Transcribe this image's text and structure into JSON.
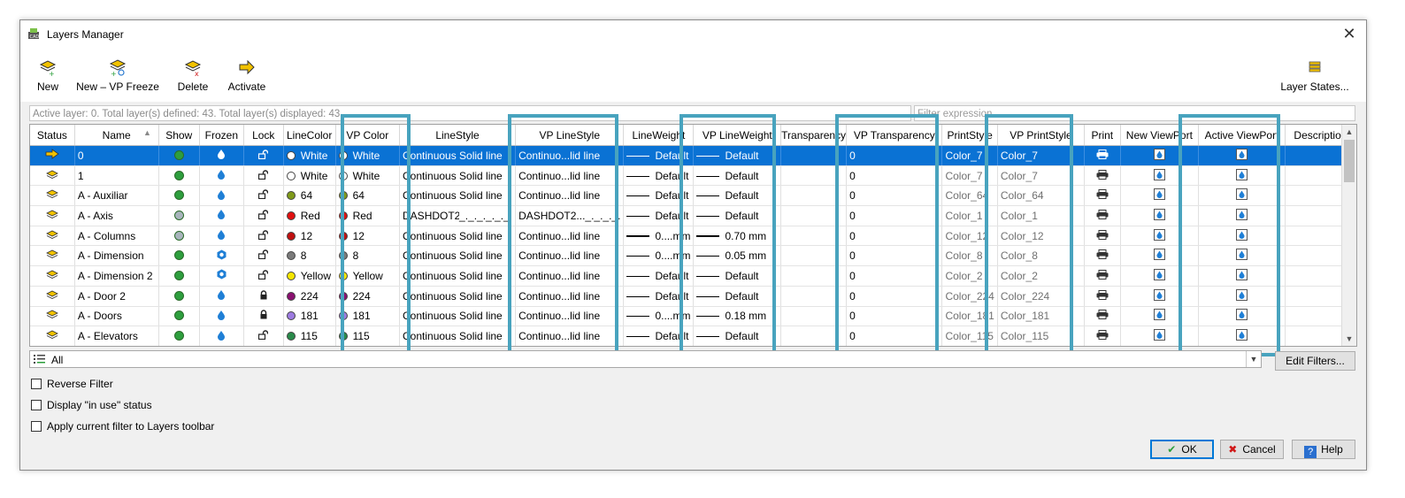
{
  "window": {
    "title": "Layers Manager"
  },
  "toolbar": {
    "new_label": "New",
    "new_vp_freeze_label": "New – VP Freeze",
    "delete_label": "Delete",
    "activate_label": "Activate",
    "layer_states_label": "Layer States..."
  },
  "status_text": "Active layer: 0. Total layer(s) defined: 43. Total layer(s) displayed: 43.",
  "filter_expression_placeholder": "Filter expression",
  "columns": [
    "Status",
    "Name",
    "Show",
    "Frozen",
    "Lock",
    "LineColor",
    "VP Color",
    "LineStyle",
    "VP LineStyle",
    "LineWeight",
    "VP LineWeight",
    "Transparency",
    "VP Transparency",
    "PrintStyle",
    "VP PrintStyle",
    "Print",
    "New ViewPort",
    "Active ViewPort",
    "Description"
  ],
  "rows": [
    {
      "name": "0",
      "show": "#2e9e3e",
      "frozen": "thawed",
      "lock": "unlocked",
      "color": "White",
      "color_hex": "#ffffff",
      "vp_color": "White",
      "vp_color_hex": "#ffffff",
      "linestyle": "Continuous",
      "linestyle_desc": "Solid line",
      "vp_linestyle": "Continuo...lid line",
      "lineweight": "Default",
      "vp_lineweight": "Default",
      "lw_thick": false,
      "transparency": "",
      "vp_transparency": "0",
      "printstyle": "Color_7",
      "vp_printstyle": "Color_7",
      "selected": true
    },
    {
      "name": "1",
      "show": "#2e9e3e",
      "frozen": "thawed",
      "lock": "unlocked",
      "color": "White",
      "color_hex": "#ffffff",
      "vp_color": "White",
      "vp_color_hex": "#ffffff",
      "linestyle": "Continuous",
      "linestyle_desc": "Solid line",
      "vp_linestyle": "Continuo...lid line",
      "lineweight": "Default",
      "vp_lineweight": "Default",
      "lw_thick": false,
      "transparency": "",
      "vp_transparency": "0",
      "printstyle": "Color_7",
      "vp_printstyle": "Color_7",
      "selected": false
    },
    {
      "name": "A - Auxiliar",
      "show": "#2e9e3e",
      "frozen": "thawed",
      "lock": "unlocked",
      "color": "64",
      "color_hex": "#7f9a1a",
      "vp_color": "64",
      "vp_color_hex": "#7f9a1a",
      "linestyle": "Continuous",
      "linestyle_desc": "Solid line",
      "vp_linestyle": "Continuo...lid line",
      "lineweight": "Default",
      "vp_lineweight": "Default",
      "lw_thick": false,
      "transparency": "",
      "vp_transparency": "0",
      "printstyle": "Color_64",
      "vp_printstyle": "Color_64",
      "selected": false
    },
    {
      "name": "A - Axis",
      "show": "#a8b4bc",
      "frozen": "thawed",
      "lock": "unlocked",
      "color": "Red",
      "color_hex": "#e01010",
      "vp_color": "Red",
      "vp_color_hex": "#e01010",
      "linestyle": "DASHDOT2",
      "linestyle_desc": "_._._._._._.",
      "vp_linestyle": "DASHDOT2..._._._._.",
      "lineweight": "Default",
      "vp_lineweight": "Default",
      "lw_thick": false,
      "transparency": "",
      "vp_transparency": "0",
      "printstyle": "Color_1",
      "vp_printstyle": "Color_1",
      "selected": false
    },
    {
      "name": "A - Columns",
      "show": "#a8b4bc",
      "frozen": "thawed",
      "lock": "unlocked",
      "color": "12",
      "color_hex": "#c01010",
      "vp_color": "12",
      "vp_color_hex": "#c01010",
      "linestyle": "Continuous",
      "linestyle_desc": "Solid line",
      "vp_linestyle": "Continuo...lid line",
      "lineweight": "0....mm",
      "vp_lineweight": "0.70 mm",
      "lw_thick": true,
      "transparency": "",
      "vp_transparency": "0",
      "printstyle": "Color_12",
      "vp_printstyle": "Color_12",
      "selected": false
    },
    {
      "name": "A - Dimension",
      "show": "#2e9e3e",
      "frozen": "frozen",
      "lock": "unlocked",
      "color": "8",
      "color_hex": "#7a7a7a",
      "vp_color": "8",
      "vp_color_hex": "#7a7a7a",
      "linestyle": "Continuous",
      "linestyle_desc": "Solid line",
      "vp_linestyle": "Continuo...lid line",
      "lineweight": "0....mm",
      "vp_lineweight": "0.05 mm",
      "lw_thick": false,
      "transparency": "",
      "vp_transparency": "0",
      "printstyle": "Color_8",
      "vp_printstyle": "Color_8",
      "selected": false
    },
    {
      "name": "A - Dimension 2",
      "show": "#2e9e3e",
      "frozen": "frozen",
      "lock": "unlocked",
      "color": "Yellow",
      "color_hex": "#f5e600",
      "vp_color": "Yellow",
      "vp_color_hex": "#f5e600",
      "linestyle": "Continuous",
      "linestyle_desc": "Solid line",
      "vp_linestyle": "Continuo...lid line",
      "lineweight": "Default",
      "vp_lineweight": "Default",
      "lw_thick": false,
      "transparency": "",
      "vp_transparency": "0",
      "printstyle": "Color_2",
      "vp_printstyle": "Color_2",
      "selected": false
    },
    {
      "name": "A - Door 2",
      "show": "#2e9e3e",
      "frozen": "thawed",
      "lock": "locked",
      "color": "224",
      "color_hex": "#8a1070",
      "vp_color": "224",
      "vp_color_hex": "#8a1070",
      "linestyle": "Continuous",
      "linestyle_desc": "Solid line",
      "vp_linestyle": "Continuo...lid line",
      "lineweight": "Default",
      "vp_lineweight": "Default",
      "lw_thick": false,
      "transparency": "",
      "vp_transparency": "0",
      "printstyle": "Color_224",
      "vp_printstyle": "Color_224",
      "selected": false
    },
    {
      "name": "A - Doors",
      "show": "#2e9e3e",
      "frozen": "thawed",
      "lock": "locked",
      "color": "181",
      "color_hex": "#9d7be0",
      "vp_color": "181",
      "vp_color_hex": "#9d7be0",
      "linestyle": "Continuous",
      "linestyle_desc": "Solid line",
      "vp_linestyle": "Continuo...lid line",
      "lineweight": "0....mm",
      "vp_lineweight": "0.18 mm",
      "lw_thick": false,
      "transparency": "",
      "vp_transparency": "0",
      "printstyle": "Color_181",
      "vp_printstyle": "Color_181",
      "selected": false
    },
    {
      "name": "A - Elevators",
      "show": "#2e9e3e",
      "frozen": "thawed",
      "lock": "unlocked",
      "color": "115",
      "color_hex": "#2a8a4a",
      "vp_color": "115",
      "vp_color_hex": "#2a8a4a",
      "linestyle": "Continuous",
      "linestyle_desc": "Solid line",
      "vp_linestyle": "Continuo...lid line",
      "lineweight": "Default",
      "vp_lineweight": "Default",
      "lw_thick": false,
      "transparency": "",
      "vp_transparency": "0",
      "printstyle": "Color_115",
      "vp_printstyle": "Color_115",
      "selected": false
    }
  ],
  "filter": {
    "current": "All",
    "edit_filters_label": "Edit Filters..."
  },
  "options": {
    "reverse_filter_label": "Reverse Filter",
    "display_in_use_label": "Display \"in use\" status",
    "apply_filter_label": "Apply current filter to Layers toolbar"
  },
  "buttons": {
    "ok_label": "OK",
    "cancel_label": "Cancel",
    "help_label": "Help"
  },
  "colors": {
    "selection": "#0a72d4",
    "highlight_frame": "#48a3be",
    "accent": "#0078d7"
  }
}
